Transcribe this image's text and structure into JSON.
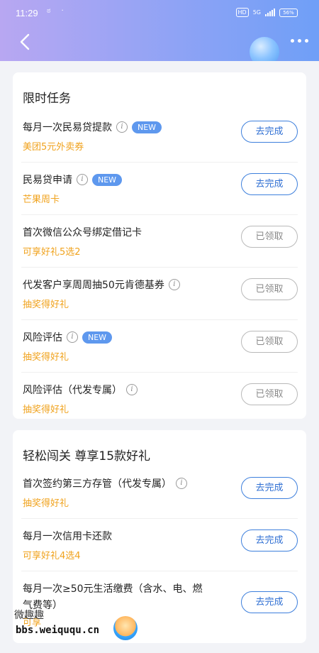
{
  "status": {
    "time": "11:29",
    "left_icons": "ಠ ·",
    "hd": "HD",
    "net": "5G",
    "battery": "56%"
  },
  "icons": {
    "back": "chevron-left-icon",
    "more": "more-dots-icon",
    "info": "info-icon"
  },
  "colors": {
    "accent_blue": "#2f6fd3",
    "reward_orange": "#f0a21c",
    "new_badge": "#5e98ee"
  },
  "section1": {
    "title": "限时任务",
    "tasks": [
      {
        "name": "每月一次民易贷提款",
        "reward": "美团5元外卖券",
        "button": "去完成"
      },
      {
        "name": "民易贷申请",
        "reward": "芒果周卡",
        "button": "去完成"
      },
      {
        "name": "首次微信公众号绑定借记卡",
        "reward": "可享好礼5选2",
        "button": "已领取"
      },
      {
        "name": "代发客户享周周抽50元肯德基券",
        "reward": "抽奖得好礼",
        "button": "已领取"
      },
      {
        "name": "风险评估",
        "reward": "抽奖得好礼",
        "button": "已领取"
      },
      {
        "name": "风险评估（代发专属）",
        "reward": "抽奖得好礼",
        "button": "已领取"
      }
    ],
    "new_label": "NEW"
  },
  "section2": {
    "title": "轻松闯关 尊享15款好礼",
    "tasks": [
      {
        "name": "首次签约第三方存管（代发专属）",
        "reward": "抽奖得好礼",
        "button": "去完成"
      },
      {
        "name": "每月一次信用卡还款",
        "reward": "可享好礼4选4",
        "button": "去完成"
      },
      {
        "name": "每月一次≥50元生活缴费（含水、电、燃",
        "name_line2": "气费等）",
        "reward": "可享",
        "button": "去完成"
      }
    ]
  },
  "watermark": {
    "text1": "微趣趣",
    "text2": "bbs.weiququ.cn"
  }
}
